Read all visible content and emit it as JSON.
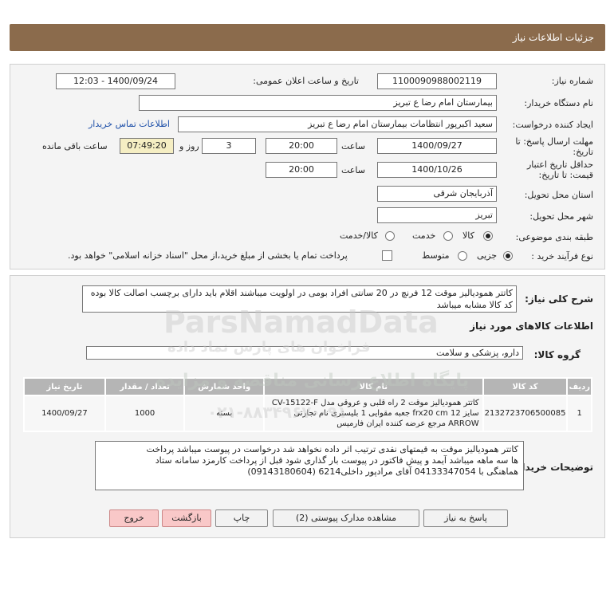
{
  "header": {
    "title": "جزئیات اطلاعات نیاز"
  },
  "form": {
    "need_number_label": "شماره نیاز:",
    "need_number": "1100090988002119",
    "announce_label": "تاریخ و ساعت اعلان عمومی:",
    "announce_value": "1400/09/24 - 12:03",
    "buyer_label": "نام دستگاه خریدار:",
    "buyer_value": "بیمارستان امام رضا  ع  تبریز",
    "creator_label": "ایجاد کننده درخواست:",
    "creator_value": "سعید اکبرپور انتظامات بیمارستان امام رضا  ع  تبریز",
    "contact_link": "اطلاعات تماس خریدار",
    "deadline_label_1": "مهلت ارسال پاسخ: تا",
    "deadline_label_2": "تاریخ:",
    "deadline_date": "1400/09/27",
    "time_label": "ساعت",
    "deadline_time": "20:00",
    "days_value": "3",
    "days_label": "روز و",
    "remaining_time": "07:49:20",
    "remaining_label": "ساعت باقی مانده",
    "validity_label_1": "حداقل تاریخ اعتبار",
    "validity_label_2": "قیمت: تا تاریخ:",
    "validity_date": "1400/10/26",
    "validity_time_label": "ساعت",
    "validity_time": "20:00",
    "province_label": "استان محل تحویل:",
    "province_value": "آذربایجان شرقی",
    "city_label": "شهر محل تحویل:",
    "city_value": "تبریز",
    "category_label": "طبقه بندی موضوعی:",
    "category_options": [
      "کالا",
      "خدمت",
      "کالا/خدمت"
    ],
    "category_selected": "کالا",
    "process_label": "نوع فرآیند خرید :",
    "process_options": [
      "جزیی",
      "متوسط"
    ],
    "process_selected": "جزیی",
    "payment_text": "پرداخت تمام یا بخشی از مبلغ خرید،از محل \"اسناد خزانه اسلامی\" خواهد بود."
  },
  "description": {
    "label": "شرح کلی نیاز:",
    "text": "کاتتر همودیالیز موقت 12 فرنچ در 20 سانتی افراد بومی در اولویت میباشند اقلام باید دارای برچسب اصالت کالا بوده کد کالا مشابه میباشد"
  },
  "goods": {
    "section_title": "اطلاعات کالاهای مورد نیاز",
    "group_label": "گروه کالا:",
    "group_value": "دارو، پزشکی و سلامت",
    "columns": [
      "ردیف",
      "کد کالا",
      "نام کالا",
      "واحد شمارش",
      "تعداد / مقدار",
      "تاریخ نیاز"
    ],
    "rows": [
      {
        "row": "1",
        "code": "2132723706500085",
        "name_lines": [
          "کاتتر همودیالیز موقت 2 راه قلبی و عروقی مدل CV-15122-F",
          "سایز 12 frx20 cm جعبه مقوایی 1 بلیستری نام تجارتی",
          "ARROW مرجع عرضه کننده ایران فارمیس"
        ],
        "unit": "بسته",
        "qty": "1000",
        "date": "1400/09/27"
      }
    ]
  },
  "buyer_notes": {
    "label": "توضیحات خریدار:",
    "lines": [
      "کاتتر همودیالیز موقت به قیمتهای نقدی ترتیب اثر داده نخواهد شد درخواست در پیوست میباشد پرداخت",
      "ها سه ماهه میباشد آیمد و پیش فاکتور در پیوست بار گذاری شود قبل از پرداخت کارمزد سامانه ستاد",
      "هماهنگی با 04133347054  آقای مرادپور داخلی6214 (09143180604)"
    ]
  },
  "buttons": {
    "reply": "پاسخ به نیاز",
    "attachments": "مشاهده مدارک پیوستی (2)",
    "print": "چاپ",
    "back": "بازگشت",
    "exit": "خروج"
  },
  "watermark": {
    "brand": "ParsNamadData",
    "line1": "پایگاه اطلاع رسانی مناقصه و مزایده",
    "line2": "فراخوان های پارس نماد داده",
    "phone": "۰۲۱-۸۸۳۴۹۶۷۰-۹۱"
  },
  "colors": {
    "header_bg": "#8b6b4c",
    "remaining_bg": "#f5eec3",
    "table_header": "#b5b5b5",
    "button_red": "#f9c8c8",
    "link": "#1d4fa8"
  }
}
